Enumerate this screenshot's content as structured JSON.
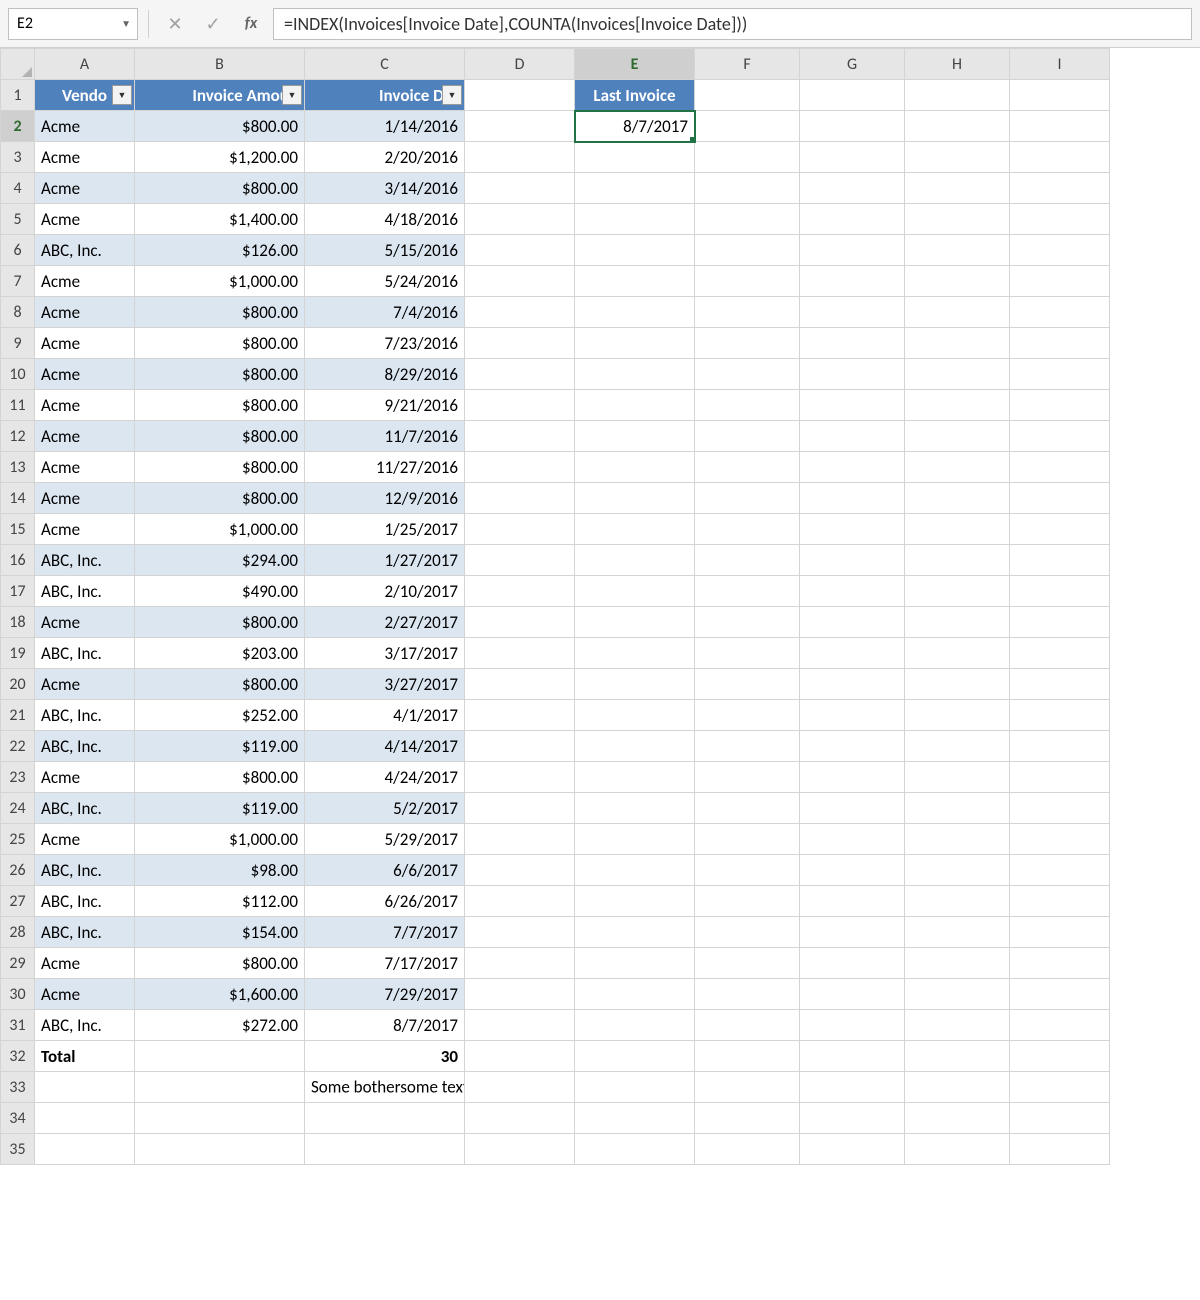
{
  "formulaBar": {
    "cellRef": "E2",
    "formula": "=INDEX(Invoices[Invoice Date],COUNTA(Invoices[Invoice Date]))",
    "fxLabel": "fx"
  },
  "columns": [
    "A",
    "B",
    "C",
    "D",
    "E",
    "F",
    "G",
    "H",
    "I"
  ],
  "tableHeaders": {
    "a": "Vendo",
    "b": "Invoice Amoun",
    "c": "Invoice Dat"
  },
  "lastInvoice": {
    "label": "Last Invoice",
    "value": "8/7/2017"
  },
  "rows": [
    {
      "n": 2,
      "vendor": "Acme",
      "amount": "$800.00",
      "date": "1/14/2016"
    },
    {
      "n": 3,
      "vendor": "Acme",
      "amount": "$1,200.00",
      "date": "2/20/2016"
    },
    {
      "n": 4,
      "vendor": "Acme",
      "amount": "$800.00",
      "date": "3/14/2016"
    },
    {
      "n": 5,
      "vendor": "Acme",
      "amount": "$1,400.00",
      "date": "4/18/2016"
    },
    {
      "n": 6,
      "vendor": "ABC, Inc.",
      "amount": "$126.00",
      "date": "5/15/2016"
    },
    {
      "n": 7,
      "vendor": "Acme",
      "amount": "$1,000.00",
      "date": "5/24/2016"
    },
    {
      "n": 8,
      "vendor": "Acme",
      "amount": "$800.00",
      "date": "7/4/2016"
    },
    {
      "n": 9,
      "vendor": "Acme",
      "amount": "$800.00",
      "date": "7/23/2016"
    },
    {
      "n": 10,
      "vendor": "Acme",
      "amount": "$800.00",
      "date": "8/29/2016"
    },
    {
      "n": 11,
      "vendor": "Acme",
      "amount": "$800.00",
      "date": "9/21/2016"
    },
    {
      "n": 12,
      "vendor": "Acme",
      "amount": "$800.00",
      "date": "11/7/2016"
    },
    {
      "n": 13,
      "vendor": "Acme",
      "amount": "$800.00",
      "date": "11/27/2016"
    },
    {
      "n": 14,
      "vendor": "Acme",
      "amount": "$800.00",
      "date": "12/9/2016"
    },
    {
      "n": 15,
      "vendor": "Acme",
      "amount": "$1,000.00",
      "date": "1/25/2017"
    },
    {
      "n": 16,
      "vendor": "ABC, Inc.",
      "amount": "$294.00",
      "date": "1/27/2017"
    },
    {
      "n": 17,
      "vendor": "ABC, Inc.",
      "amount": "$490.00",
      "date": "2/10/2017"
    },
    {
      "n": 18,
      "vendor": "Acme",
      "amount": "$800.00",
      "date": "2/27/2017"
    },
    {
      "n": 19,
      "vendor": "ABC, Inc.",
      "amount": "$203.00",
      "date": "3/17/2017"
    },
    {
      "n": 20,
      "vendor": "Acme",
      "amount": "$800.00",
      "date": "3/27/2017"
    },
    {
      "n": 21,
      "vendor": "ABC, Inc.",
      "amount": "$252.00",
      "date": "4/1/2017"
    },
    {
      "n": 22,
      "vendor": "ABC, Inc.",
      "amount": "$119.00",
      "date": "4/14/2017"
    },
    {
      "n": 23,
      "vendor": "Acme",
      "amount": "$800.00",
      "date": "4/24/2017"
    },
    {
      "n": 24,
      "vendor": "ABC, Inc.",
      "amount": "$119.00",
      "date": "5/2/2017"
    },
    {
      "n": 25,
      "vendor": "Acme",
      "amount": "$1,000.00",
      "date": "5/29/2017"
    },
    {
      "n": 26,
      "vendor": "ABC, Inc.",
      "amount": "$98.00",
      "date": "6/6/2017"
    },
    {
      "n": 27,
      "vendor": "ABC, Inc.",
      "amount": "$112.00",
      "date": "6/26/2017"
    },
    {
      "n": 28,
      "vendor": "ABC, Inc.",
      "amount": "$154.00",
      "date": "7/7/2017"
    },
    {
      "n": 29,
      "vendor": "Acme",
      "amount": "$800.00",
      "date": "7/17/2017"
    },
    {
      "n": 30,
      "vendor": "Acme",
      "amount": "$1,600.00",
      "date": "7/29/2017"
    },
    {
      "n": 31,
      "vendor": "ABC, Inc.",
      "amount": "$272.00",
      "date": "8/7/2017"
    }
  ],
  "totalRow": {
    "n": 32,
    "label": "Total",
    "count": "30"
  },
  "extra": {
    "n": 33,
    "text": "Some bothersome text"
  },
  "blankRows": [
    34,
    35
  ]
}
